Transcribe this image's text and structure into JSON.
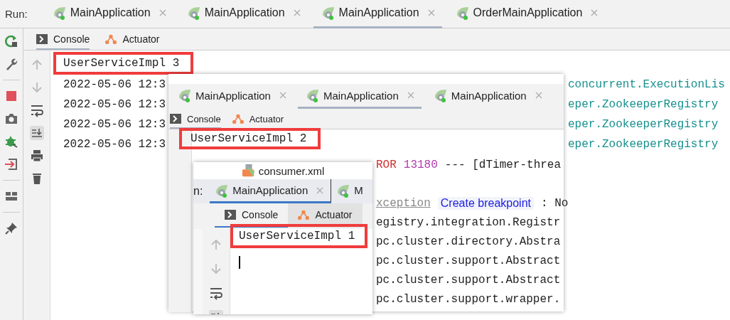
{
  "main_window": {
    "run_label": "Run:",
    "tabs": [
      {
        "label": "MainApplication",
        "selected": false
      },
      {
        "label": "MainApplication",
        "selected": false
      },
      {
        "label": "MainApplication",
        "selected": true
      },
      {
        "label": "OrderMainApplication",
        "selected": false
      }
    ],
    "subtabs": [
      {
        "label": "Console",
        "kind": "console",
        "selected": true
      },
      {
        "label": "Actuator",
        "kind": "actuator",
        "selected": false
      }
    ],
    "highlighted_line": "UserServiceImpl 3",
    "log_lines": [
      {
        "start": "2022-05-06 12:3",
        "end": "concurrent.ExecutionLis"
      },
      {
        "start": "2022-05-06 12:3",
        "end": "eper.ZookeeperRegistry"
      },
      {
        "start": "2022-05-06 12:3",
        "end": "eper.ZookeeperRegistry"
      },
      {
        "start": "2022-05-06 12:3",
        "end": "eper.ZookeeperRegistry"
      }
    ]
  },
  "second_window": {
    "tabs": [
      {
        "label": "MainApplication",
        "selected": false
      },
      {
        "label": "MainApplication",
        "selected": true
      },
      {
        "label": "MainApplication",
        "selected": false
      }
    ],
    "subtabs": [
      {
        "label": "Console",
        "kind": "console",
        "selected": true
      },
      {
        "label": "Actuator",
        "kind": "actuator",
        "selected": false
      }
    ],
    "highlighted_line": "UserServiceImpl 2",
    "log_lines": [
      [
        {
          "text": "ROR",
          "kind": "error"
        },
        {
          "text": "13180",
          "kind": "pid"
        },
        {
          "text": "--- [dTimer-threa",
          "kind": "plain"
        }
      ],
      [
        {
          "text": "xception",
          "kind": "link"
        },
        {
          "text": "Create breakpoint",
          "kind": "action"
        },
        {
          "text": ": No",
          "kind": "plain"
        }
      ],
      [
        {
          "text": "egistry.integration.Registr",
          "kind": "plain"
        }
      ],
      [
        {
          "text": "pc.cluster.directory.Abstra",
          "kind": "plain"
        }
      ],
      [
        {
          "text": "pc.cluster.support.Abstract",
          "kind": "plain"
        }
      ],
      [
        {
          "text": "pc.cluster.support.Abstract",
          "kind": "plain"
        }
      ],
      [
        {
          "text": "pc.cluster.support.wrapper.",
          "kind": "plain"
        }
      ]
    ]
  },
  "third_window": {
    "title": "consumer.xml",
    "run_label": "n:",
    "tabs": [
      {
        "label": "MainApplication",
        "selected": true
      },
      {
        "label": "M",
        "selected": false
      }
    ],
    "subtabs": [
      {
        "label": "Console",
        "kind": "console",
        "selected": true
      },
      {
        "label": "Actuator",
        "kind": "actuator",
        "selected": false
      }
    ],
    "highlighted_line": "UserServiceImpl 1"
  }
}
